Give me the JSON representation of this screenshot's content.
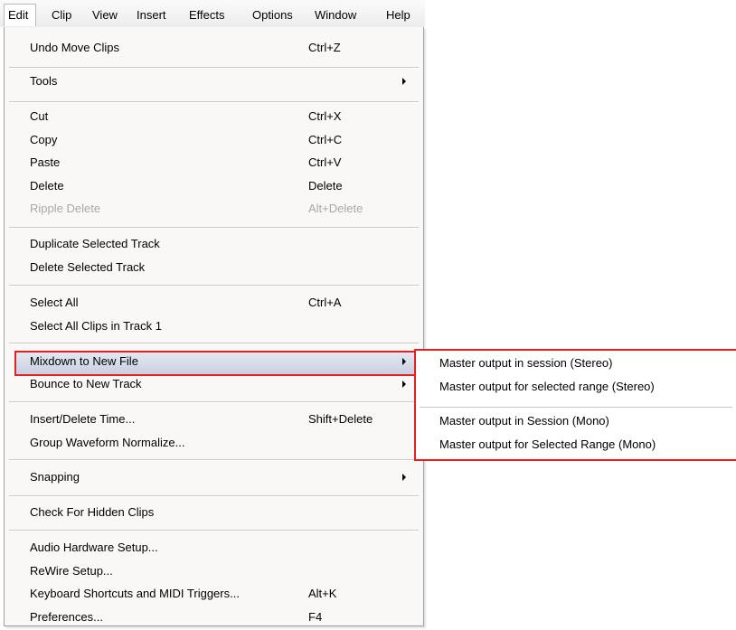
{
  "menubar": {
    "items": [
      "Edit",
      "Clip",
      "View",
      "Insert",
      "Effects",
      "Options",
      "Window",
      "Help"
    ]
  },
  "edit_menu": {
    "items": [
      {
        "label": "Undo Move Clips",
        "shortcut": "Ctrl+Z"
      },
      {
        "label": "Tools"
      },
      {
        "label": "Cut",
        "shortcut": "Ctrl+X"
      },
      {
        "label": "Copy",
        "shortcut": "Ctrl+C"
      },
      {
        "label": "Paste",
        "shortcut": "Ctrl+V"
      },
      {
        "label": "Delete",
        "shortcut": "Delete"
      },
      {
        "label": "Ripple Delete",
        "shortcut": "Alt+Delete"
      },
      {
        "label": "Duplicate Selected Track"
      },
      {
        "label": "Delete Selected Track"
      },
      {
        "label": "Select All",
        "shortcut": "Ctrl+A"
      },
      {
        "label": "Select All Clips in Track 1"
      },
      {
        "label": "Mixdown to New File"
      },
      {
        "label": "Bounce to New Track"
      },
      {
        "label": "Insert/Delete Time...",
        "shortcut": "Shift+Delete"
      },
      {
        "label": "Group Waveform Normalize..."
      },
      {
        "label": "Snapping"
      },
      {
        "label": "Check For Hidden Clips"
      },
      {
        "label": "Audio Hardware Setup..."
      },
      {
        "label": "ReWire Setup..."
      },
      {
        "label": "Keyboard Shortcuts and MIDI Triggers...",
        "shortcut": "Alt+K"
      },
      {
        "label": "Preferences...",
        "shortcut": "F4"
      }
    ]
  },
  "mixdown_submenu": {
    "items": [
      {
        "label": "Master output in session (Stereo)"
      },
      {
        "label": "Master output for selected range (Stereo)"
      },
      {
        "label": "Master output in Session (Mono)"
      },
      {
        "label": "Master output for Selected Range (Mono)"
      }
    ]
  },
  "colors": {
    "highlight_outline": "#e52020",
    "menu_background": "#f9f8f6",
    "disabled_text": "#a8a8a8"
  }
}
